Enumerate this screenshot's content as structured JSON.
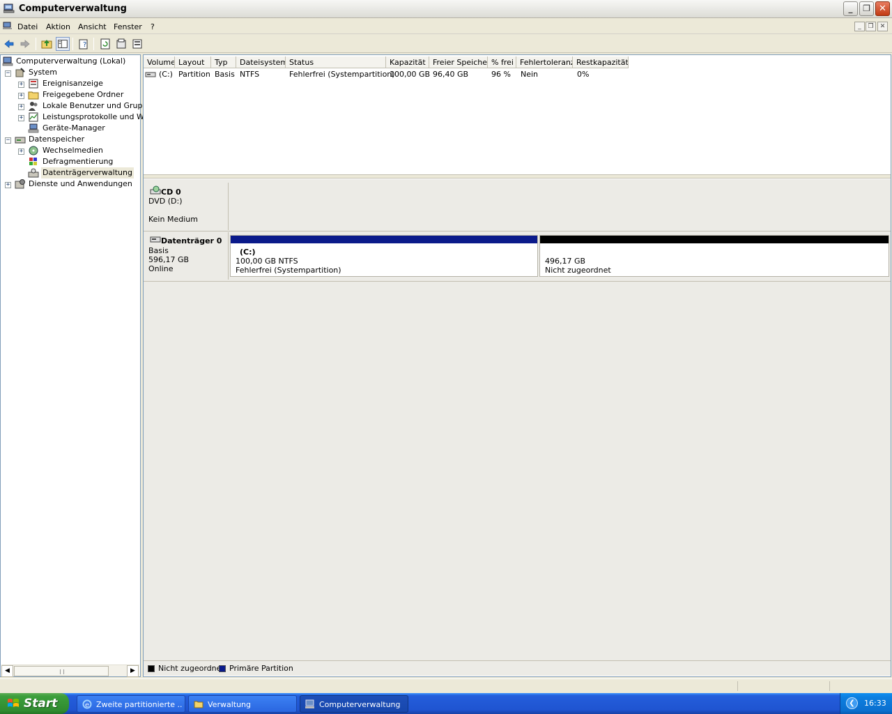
{
  "window": {
    "title": "Computerverwaltung"
  },
  "menu": {
    "items": [
      "Datei",
      "Aktion",
      "Ansicht",
      "Fenster",
      "?"
    ]
  },
  "tree": {
    "items": [
      {
        "label": "Computerverwaltung (Lokal)",
        "icon": "computer-icon"
      },
      {
        "label": "System",
        "icon": "tools-icon"
      },
      {
        "label": "Ereignisanzeige",
        "icon": "event-viewer-icon"
      },
      {
        "label": "Freigegebene Ordner",
        "icon": "shared-folder-icon"
      },
      {
        "label": "Lokale Benutzer und Gruppen",
        "icon": "users-icon"
      },
      {
        "label": "Leistungsprotokolle und Warnungen",
        "icon": "performance-icon"
      },
      {
        "label": "Geräte-Manager",
        "icon": "device-manager-icon"
      },
      {
        "label": "Datenspeicher",
        "icon": "storage-icon"
      },
      {
        "label": "Wechselmedien",
        "icon": "removable-media-icon"
      },
      {
        "label": "Defragmentierung",
        "icon": "defrag-icon"
      },
      {
        "label": "Datenträgerverwaltung",
        "icon": "disk-management-icon"
      },
      {
        "label": "Dienste und Anwendungen",
        "icon": "services-icon"
      }
    ]
  },
  "volumes": {
    "columns": [
      "Volume",
      "Layout",
      "Typ",
      "Dateisystem",
      "Status",
      "Kapazität",
      "Freier Speicher",
      "% frei",
      "Fehlertoleranz",
      "Restkapazität"
    ],
    "rows": [
      [
        "(C:)",
        "Partition",
        "Basis",
        "NTFS",
        "Fehlerfrei (Systempartition)",
        "100,00 GB",
        "96,40 GB",
        "96 %",
        "Nein",
        "0%"
      ]
    ]
  },
  "disks": {
    "cd0": {
      "name": "CD 0",
      "type": "DVD (D:)",
      "status": "Kein Medium"
    },
    "disk0": {
      "name": "Datenträger 0",
      "type": "Basis",
      "size": "596,17 GB",
      "status": "Online",
      "partitions": [
        {
          "name": "(C:)",
          "size": "100,00 GB NTFS",
          "status": "Fehlerfrei (Systempartition)",
          "color": "#0a1a8a"
        },
        {
          "size": "496,17 GB",
          "status": "Nicht zugeordnet",
          "color": "#000000"
        }
      ]
    }
  },
  "legend": [
    {
      "label": "Nicht zugeordnet",
      "color": "#000000"
    },
    {
      "label": "Primäre Partition",
      "color": "#0a1a8a"
    }
  ],
  "taskbar": {
    "start_label": "Start",
    "tasks": [
      {
        "label": "Zweite partitionierte ...",
        "icon": "internet-explorer-icon"
      },
      {
        "label": "Verwaltung",
        "icon": "folder-icon"
      },
      {
        "label": "Computerverwaltung",
        "icon": "computer-icon"
      }
    ],
    "clock": "16:33"
  }
}
